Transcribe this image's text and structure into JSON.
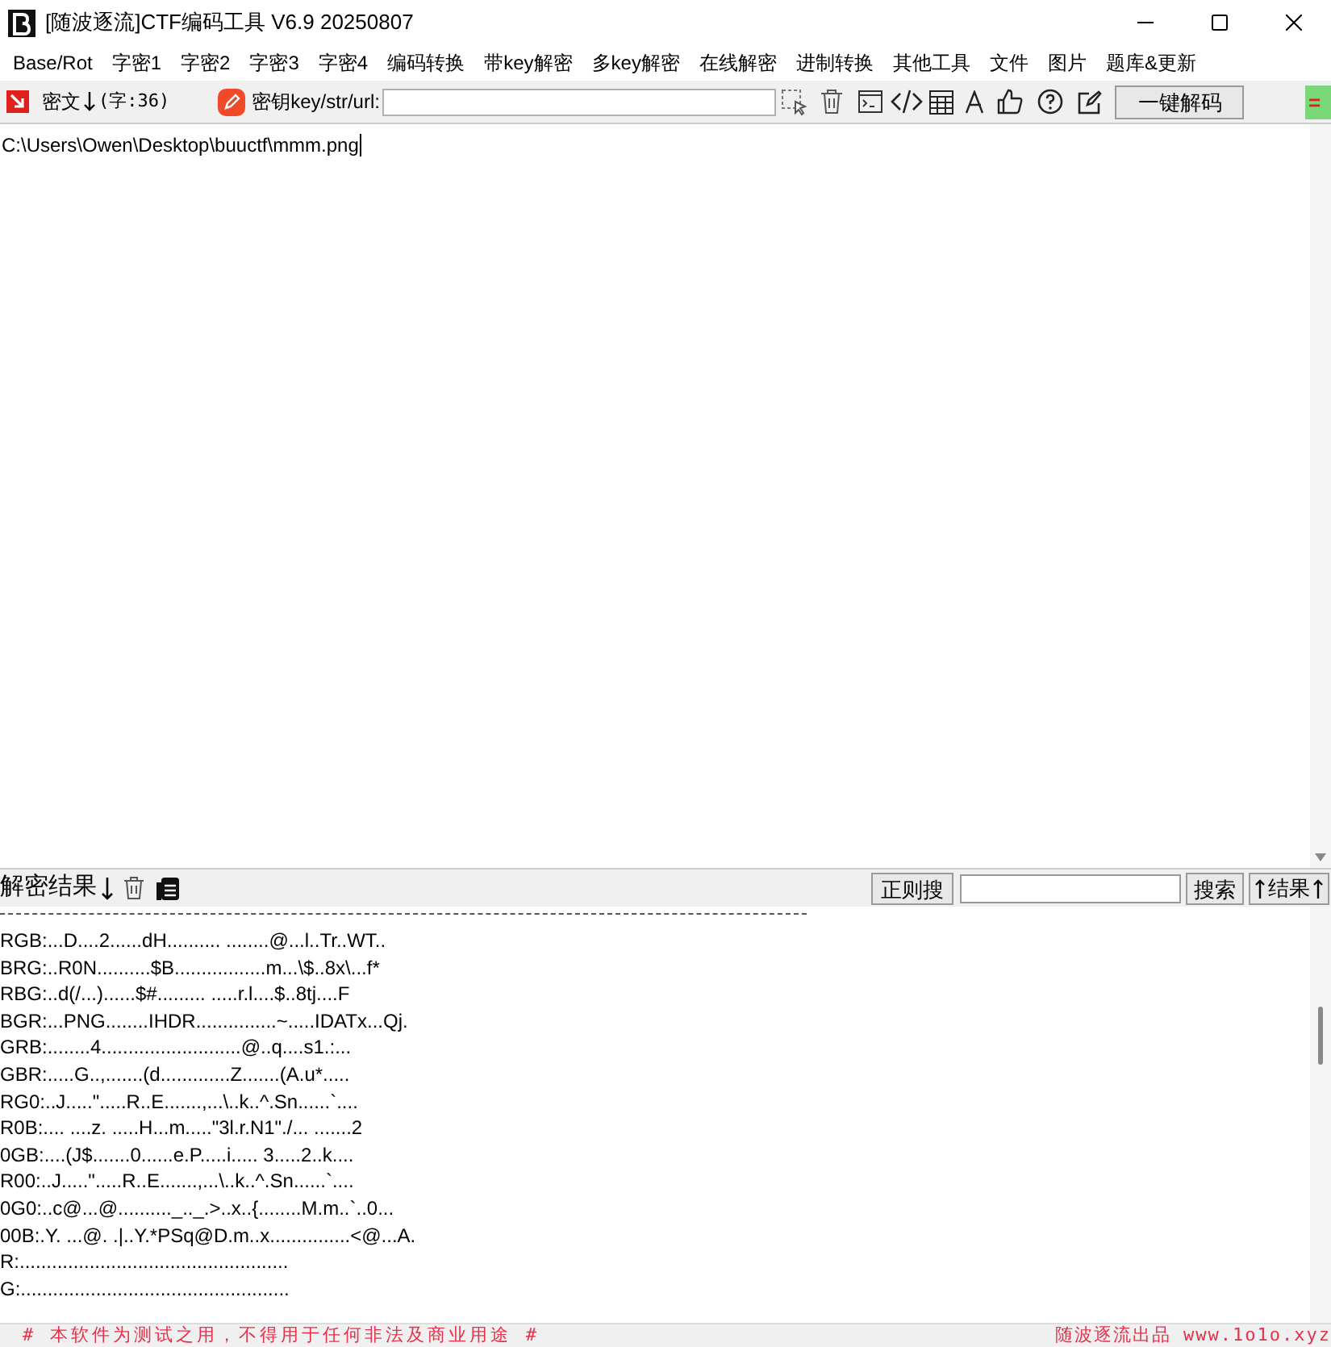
{
  "window": {
    "title": "[随波逐流]CTF编码工具 V6.9  20250807"
  },
  "menu": [
    "Base/Rot",
    "字密1",
    "字密2",
    "字密3",
    "字密4",
    "编码转换",
    "带key解密",
    "多key解密",
    "在线解密",
    "进制转换",
    "其他工具",
    "文件",
    "图片",
    "题库&更新"
  ],
  "toolbar": {
    "cipher_label": "密文",
    "count": "(字:36)",
    "key_label": "密钥key/str/url:",
    "decode_button": "一键解码",
    "arrow": "="
  },
  "input": {
    "value": "C:\\Users\\Owen\\Desktop\\buuctf\\mmm.png"
  },
  "results_bar": {
    "label": "解密结果",
    "regex_button": "正则搜",
    "search_button": "搜索",
    "results_button": "结果"
  },
  "output": {
    "lines": [
      "RGB:...D....2......dH.......... ........@...l..Tr..WT..",
      "BRG:..R0N..........$B.................m...\\$..8x\\...f*",
      "RBG:..d(/...)......$#......... .....r.l....$..8tj....F",
      "BGR:...PNG........IHDR...............~.....IDATx...Qj.",
      "GRB:........4..........................@..q....s1.:...",
      "GBR:.....G..,.......(d.............Z.......(A.u*.....",
      "RG0:..J.....\".....R..E.......,...\\..k..^.Sn......`....",
      "R0B:.... ....z. .....H...m.....\"3l.r.N1\"./... .......2",
      "0GB:....(J$.......0......e.P.....i..... 3.....2..k....",
      "R00:..J.....\".....R..E.......,...\\..k..^.Sn......`....",
      "0G0:..c@...@.........._.._.>..x..{........M.m..`..0...",
      "00B:.Y. ...@. .|..Y.*PSq@D.m..x...............<@...A.",
      "R:..................................................",
      "G:.................................................."
    ]
  },
  "status_bar": {
    "notice": "# 本软件为测试之用，不得用于任何非法及商业用途 #",
    "credit": "随波逐流出品 www.1o1o.xyz"
  }
}
